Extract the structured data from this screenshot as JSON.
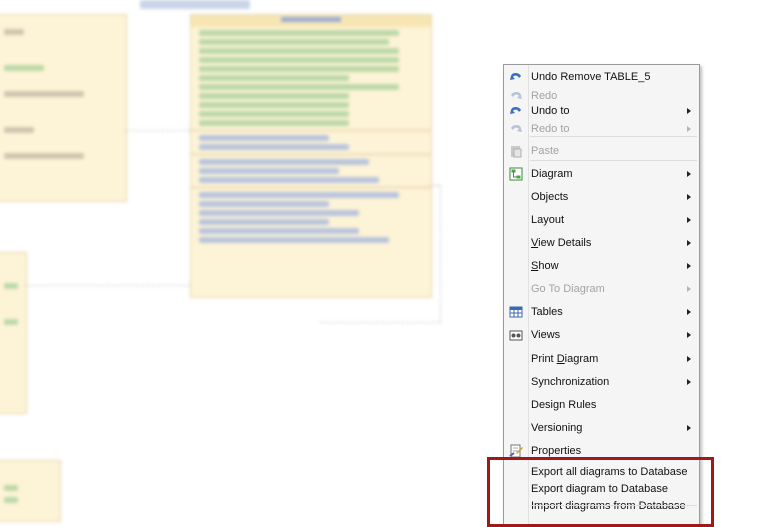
{
  "menu": {
    "items": [
      {
        "label": "Undo Remove TABLE_5",
        "enabled": true,
        "submenu": false,
        "icon": "undo-icon"
      },
      {
        "label": "Redo",
        "enabled": false,
        "submenu": false,
        "icon": "redo-icon"
      },
      {
        "label": "Undo to",
        "enabled": true,
        "submenu": true,
        "icon": "undo-icon"
      },
      {
        "label": "Redo to",
        "enabled": false,
        "submenu": true,
        "icon": "redo-icon"
      },
      {
        "label": "Paste",
        "enabled": false,
        "submenu": false,
        "icon": "paste-icon"
      },
      {
        "label": "Diagram",
        "enabled": true,
        "submenu": true,
        "icon": "diagram-icon"
      },
      {
        "label": "Objects",
        "enabled": true,
        "submenu": true
      },
      {
        "label": "Layout",
        "enabled": true,
        "submenu": true
      },
      {
        "label": "View Details",
        "enabled": true,
        "submenu": true,
        "underline": "V"
      },
      {
        "label": "Show",
        "enabled": true,
        "submenu": true,
        "underline": "S"
      },
      {
        "label": "Go To Diagram",
        "enabled": false,
        "submenu": true
      },
      {
        "label": "Tables",
        "enabled": true,
        "submenu": true,
        "icon": "table-icon"
      },
      {
        "label": "Views",
        "enabled": true,
        "submenu": true,
        "icon": "views-icon"
      },
      {
        "label": "Print Diagram",
        "enabled": true,
        "submenu": true,
        "underline": "D"
      },
      {
        "label": "Synchronization",
        "enabled": true,
        "submenu": true
      },
      {
        "label": "Design Rules",
        "enabled": true,
        "submenu": false
      },
      {
        "label": "Versioning",
        "enabled": true,
        "submenu": true
      },
      {
        "label": "Properties",
        "enabled": true,
        "submenu": false,
        "icon": "properties-icon"
      },
      {
        "label": "Export all diagrams to Database",
        "enabled": true,
        "submenu": false
      },
      {
        "label": "Export diagram to Database",
        "enabled": true,
        "submenu": false
      },
      {
        "label": "Import diagrams from Database",
        "enabled": true,
        "submenu": false
      }
    ]
  },
  "colors": {
    "highlight_box": "#a01818",
    "disabled_text": "#a3a3a3"
  }
}
